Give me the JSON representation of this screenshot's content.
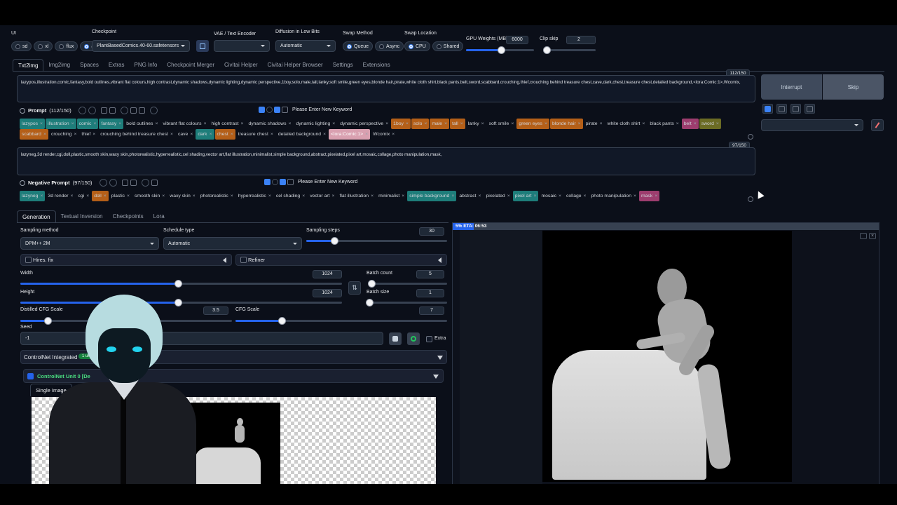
{
  "top": {
    "ui_label": "UI",
    "ui_options": [
      "sd",
      "xl",
      "flux",
      "all"
    ],
    "ui_selected": "all",
    "checkpoint_label": "Checkpoint",
    "checkpoint_value": "PlantBasedComics.40-60.safetensors",
    "vae_label": "VAE / Text Encoder",
    "vae_value": "",
    "diffusion_label": "Diffusion in Low Bits",
    "diffusion_value": "Automatic",
    "swap_method_label": "Swap Method",
    "swap_method_options": [
      "Queue",
      "Async"
    ],
    "swap_location_label": "Swap Location",
    "swap_location_options": [
      "CPU",
      "Shared"
    ],
    "gpu_label": "GPU Weights (MB)",
    "gpu_value": "6000",
    "gpu_fraction": 0.52,
    "clip_label": "Clip skip",
    "clip_value": "2",
    "clip_fraction": 0.05
  },
  "tabs": [
    "Txt2img",
    "Img2img",
    "Spaces",
    "Extras",
    "PNG Info",
    "Checkpoint Merger",
    "Civitai Helper",
    "Civitai Helper Browser",
    "Settings",
    "Extensions"
  ],
  "prompt": {
    "counter": "112/150",
    "text": "lazypos,illustration,comic,fantasy,bold outlines,vibrant flat colours,high contrast,dynamic shadows,dynamic lighting,dynamic perspective,1boy,solo,male,tall,lanky,soft smile,green eyes,blonde hair,pirate,white cloth shirt,black pants,belt,sword,scabbard,crouching,thief,crouching behind treasure chest,cave,dark,chest,treasure chest,detailed background,<lora:Comic:1>,Wcomix,",
    "label": "Prompt",
    "label_count": "(112/150)",
    "keyword_placeholder": "Please Enter New Keyword",
    "tags": [
      {
        "t": "lazypos",
        "c": "teal"
      },
      {
        "t": "illustration",
        "c": "teal"
      },
      {
        "t": "comic",
        "c": "teal"
      },
      {
        "t": "fantasy",
        "c": "teal"
      },
      {
        "t": "bold outlines",
        "c": ""
      },
      {
        "t": "vibrant flat colours",
        "c": ""
      },
      {
        "t": "high contrast",
        "c": ""
      },
      {
        "t": "dynamic shadows",
        "c": ""
      },
      {
        "t": "dynamic lighting",
        "c": ""
      },
      {
        "t": "dynamic perspective",
        "c": ""
      },
      {
        "t": "1boy",
        "c": "orange"
      },
      {
        "t": "solo",
        "c": "orange"
      },
      {
        "t": "male",
        "c": "orange"
      },
      {
        "t": "tall",
        "c": "orange"
      },
      {
        "t": "lanky",
        "c": ""
      },
      {
        "t": "soft smile",
        "c": ""
      },
      {
        "t": "green eyes",
        "c": "orange"
      },
      {
        "t": "blonde hair",
        "c": "orange"
      },
      {
        "t": "pirate",
        "c": ""
      },
      {
        "t": "white cloth shirt",
        "c": ""
      },
      {
        "t": "black pants",
        "c": ""
      },
      {
        "t": "belt",
        "c": "pink"
      },
      {
        "t": "sword",
        "c": "olive"
      },
      {
        "t": "scabbard",
        "c": "orange"
      },
      {
        "t": "crouching",
        "c": ""
      },
      {
        "t": "thief",
        "c": ""
      },
      {
        "t": "crouching behind treasure chest",
        "c": ""
      },
      {
        "t": "cave",
        "c": ""
      },
      {
        "t": "dark",
        "c": "teal"
      },
      {
        "t": "chest",
        "c": "orange"
      },
      {
        "t": "treasure chest",
        "c": ""
      },
      {
        "t": "detailed background",
        "c": ""
      },
      {
        "t": "<lora:Comic:1>",
        "c": "lora"
      },
      {
        "t": "Wcomix",
        "c": ""
      }
    ]
  },
  "negative": {
    "counter": "97/150",
    "text": "lazyneg,3d render,cgi,doll,plastic,smooth skin,waxy skin,photorealistic,hyperrealistic,cel shading,vector art,flat illustration,minimalist,simple background,abstract,pixelated,pixel art,mosaic,collage,photo manipulation,mask,",
    "label": "Negative Prompt",
    "label_count": "(97/150)",
    "keyword_placeholder": "Please Enter New Keyword",
    "tags": [
      {
        "t": "lazyneg",
        "c": "teal"
      },
      {
        "t": "3d render",
        "c": ""
      },
      {
        "t": "cgi",
        "c": ""
      },
      {
        "t": "doll",
        "c": "orange"
      },
      {
        "t": "plastic",
        "c": ""
      },
      {
        "t": "smooth skin",
        "c": ""
      },
      {
        "t": "waxy skin",
        "c": ""
      },
      {
        "t": "photorealistic",
        "c": ""
      },
      {
        "t": "hyperrealistic",
        "c": ""
      },
      {
        "t": "cel shading",
        "c": ""
      },
      {
        "t": "vector art",
        "c": ""
      },
      {
        "t": "flat illustration",
        "c": ""
      },
      {
        "t": "minimalist",
        "c": ""
      },
      {
        "t": "simple background",
        "c": "teal"
      },
      {
        "t": "abstract",
        "c": ""
      },
      {
        "t": "pixelated",
        "c": ""
      },
      {
        "t": "pixel art",
        "c": "teal"
      },
      {
        "t": "mosaic",
        "c": ""
      },
      {
        "t": "collage",
        "c": ""
      },
      {
        "t": "photo manipulation",
        "c": ""
      },
      {
        "t": "mask",
        "c": "pink"
      }
    ]
  },
  "buttons": {
    "interrupt": "Interrupt",
    "skip": "Skip"
  },
  "subtabs": [
    "Generation",
    "Textual Inversion",
    "Checkpoints",
    "Lora"
  ],
  "gen": {
    "sampling_method_label": "Sampling method",
    "sampling_method": "DPM++ 2M",
    "schedule_label": "Schedule type",
    "schedule": "Automatic",
    "steps_label": "Sampling steps",
    "steps": "30",
    "steps_fraction": 0.2,
    "hires_label": "Hires. fix",
    "refiner_label": "Refiner",
    "width_label": "Width",
    "width": "1024",
    "width_fraction": 0.49,
    "height_label": "Height",
    "height": "1024",
    "height_fraction": 0.49,
    "batch_count_label": "Batch count",
    "batch_count": "5",
    "batch_count_fraction": 0.03,
    "batch_size_label": "Batch size",
    "batch_size": "1",
    "batch_size_fraction": 0.0,
    "dcfg_label": "Distilled CFG Scale",
    "dcfg": "3.5",
    "dcfg_fraction": 0.13,
    "cfg_label": "CFG Scale",
    "cfg": "7",
    "cfg_fraction": 0.22,
    "seed_label": "Seed",
    "seed": "-1",
    "extra_label": "Extra",
    "controlnet_label": "ControlNet Integrated",
    "controlnet_badge": "1 unit",
    "unit_label": "ControlNet Unit 0 [De",
    "single_image_tab": "Single Image",
    "batch_tab": "Ba"
  },
  "progress": {
    "text": "5% ETA: 06:53",
    "fraction": 0.05
  },
  "colors": {
    "accent": "#2563eb",
    "teal": "#1e7d7a",
    "orange": "#b45f18",
    "pink": "#9d3d6e",
    "olive": "#6b6b24",
    "lora": "#d9a0b0"
  }
}
